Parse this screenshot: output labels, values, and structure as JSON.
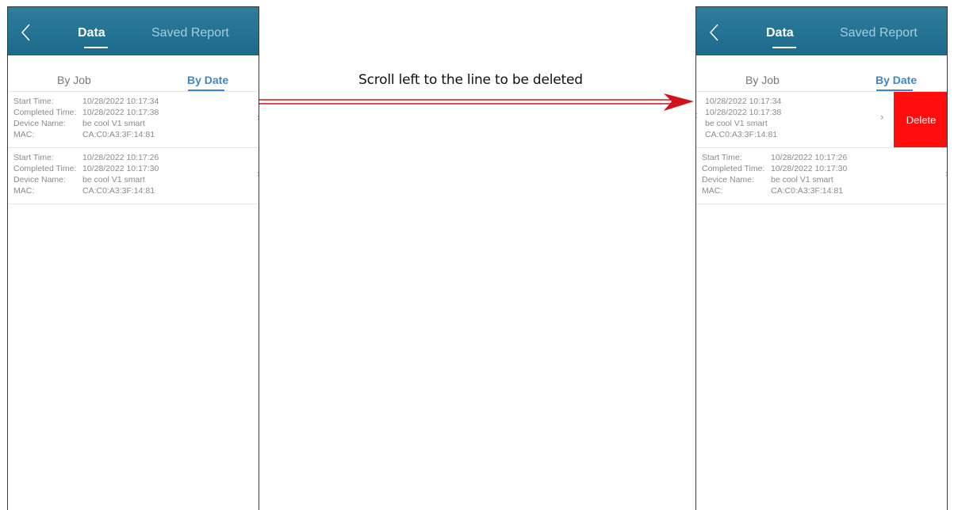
{
  "header": {
    "tabs": [
      {
        "label": "Data",
        "active": true
      },
      {
        "label": "Saved Report",
        "active": false
      }
    ]
  },
  "subtabs": [
    {
      "label": "By Job",
      "active": false
    },
    {
      "label": "By Date",
      "active": true
    }
  ],
  "field_labels": {
    "start": "Start Time:",
    "completed": "Completed Time:",
    "device": "Device Name:",
    "mac": "MAC:"
  },
  "records": [
    {
      "start": "10/28/2022 10:17:34",
      "completed": "10/28/2022 10:17:38",
      "device": "be cool V1 smart",
      "mac": "CA:C0:A3:3F:14:81"
    },
    {
      "start": "10/28/2022 10:17:26",
      "completed": "10/28/2022 10:17:30",
      "device": "be cool V1 smart",
      "mac": "CA:C0:A3:3F:14:81"
    }
  ],
  "delete_label": "Delete",
  "instruction": "Scroll left to the line to be deleted",
  "colors": {
    "header": "#1c6a8b",
    "accent": "#3f86c9",
    "delete": "#ff0d0d",
    "arrow": "#d0121b"
  }
}
